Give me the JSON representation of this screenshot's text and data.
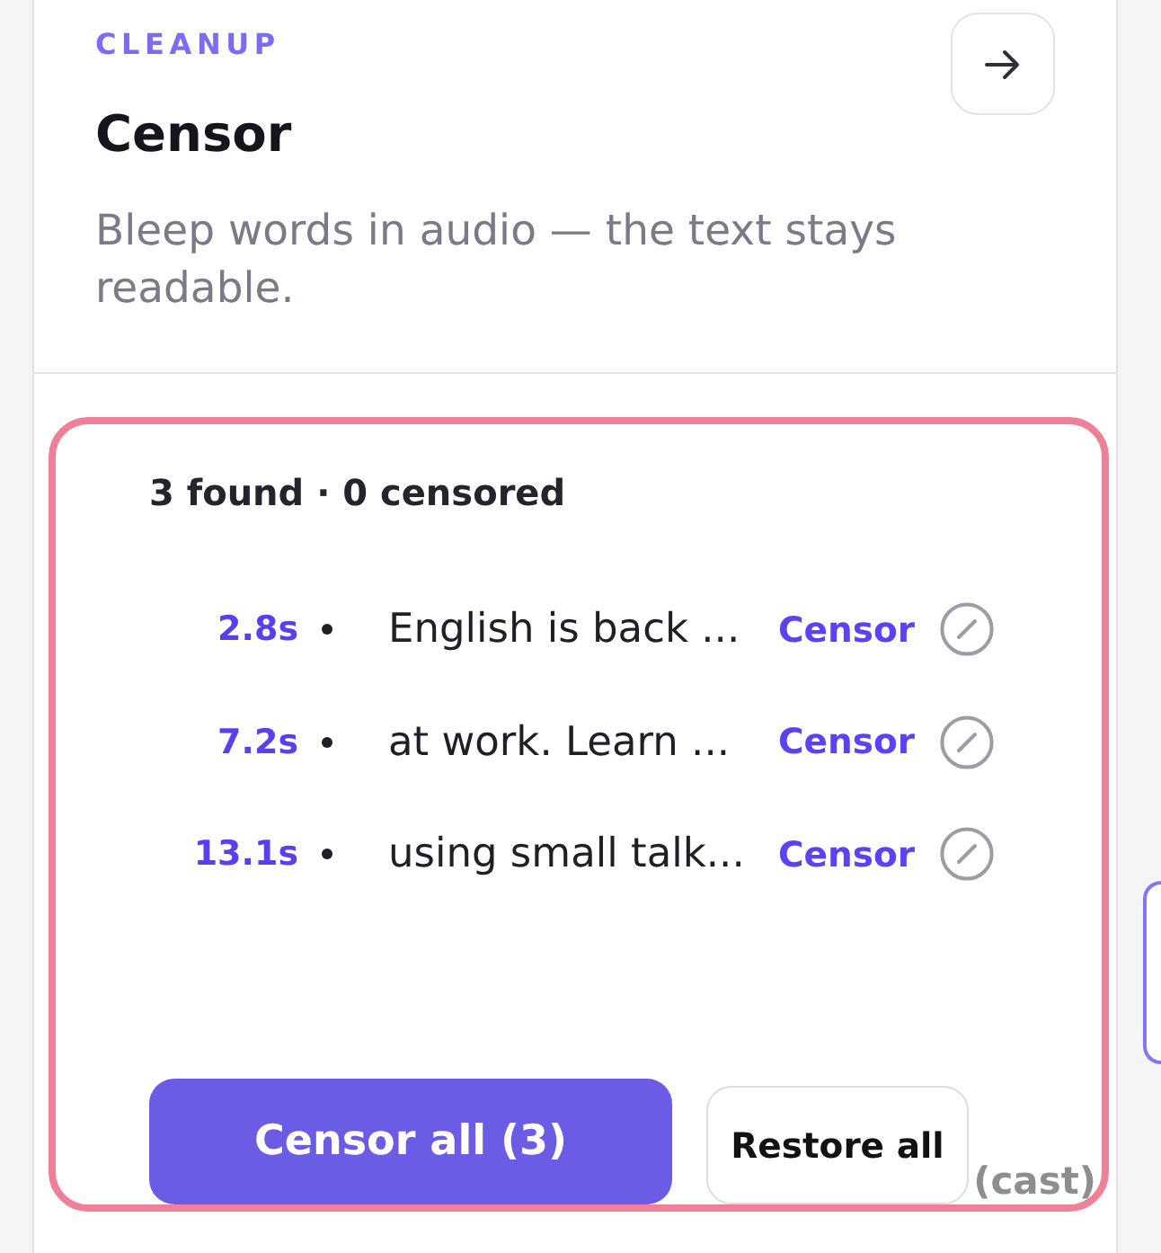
{
  "header": {
    "eyebrow": "CLEANUP",
    "title": "Censor",
    "description": "Bleep words in audio — the text stays readable."
  },
  "results": {
    "summary": "3 found · 0 censored",
    "matches": [
      {
        "time": "2.8s",
        "text": "English is back ...",
        "action": "Censor"
      },
      {
        "time": "7.2s",
        "text": "at work. Learn ...",
        "action": "Censor"
      },
      {
        "time": "13.1s",
        "text": "using small talk...",
        "action": "Censor"
      }
    ]
  },
  "buttons": [
    {
      "label": "Censor all (3)",
      "kind": "primary"
    },
    {
      "label": "Restore all",
      "kind": "secondary"
    }
  ],
  "overlay_label": "(cast)"
}
